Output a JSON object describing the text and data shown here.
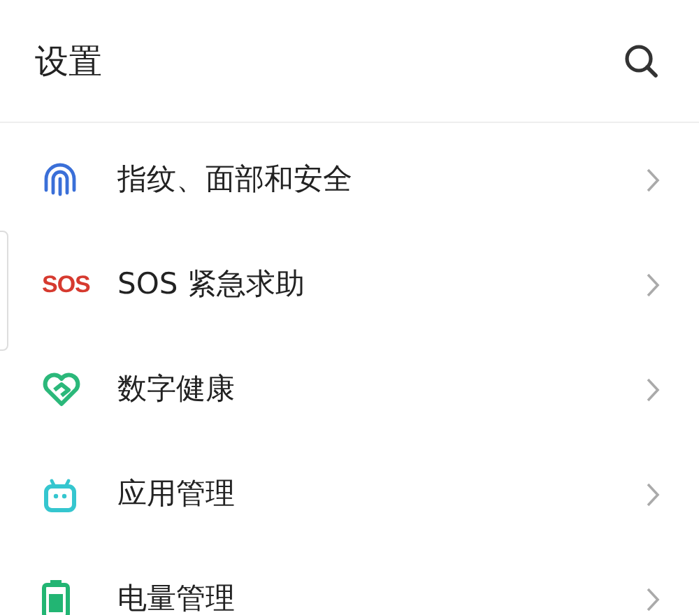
{
  "header": {
    "title": "设置"
  },
  "items": [
    {
      "kind": "fingerprint",
      "label": "指纹、面部和安全"
    },
    {
      "kind": "sos",
      "icon_text": "SOS",
      "label": "SOS 紧急求助"
    },
    {
      "kind": "heart",
      "label": "数字健康"
    },
    {
      "kind": "android",
      "label": "应用管理"
    },
    {
      "kind": "battery",
      "label": "电量管理"
    }
  ]
}
